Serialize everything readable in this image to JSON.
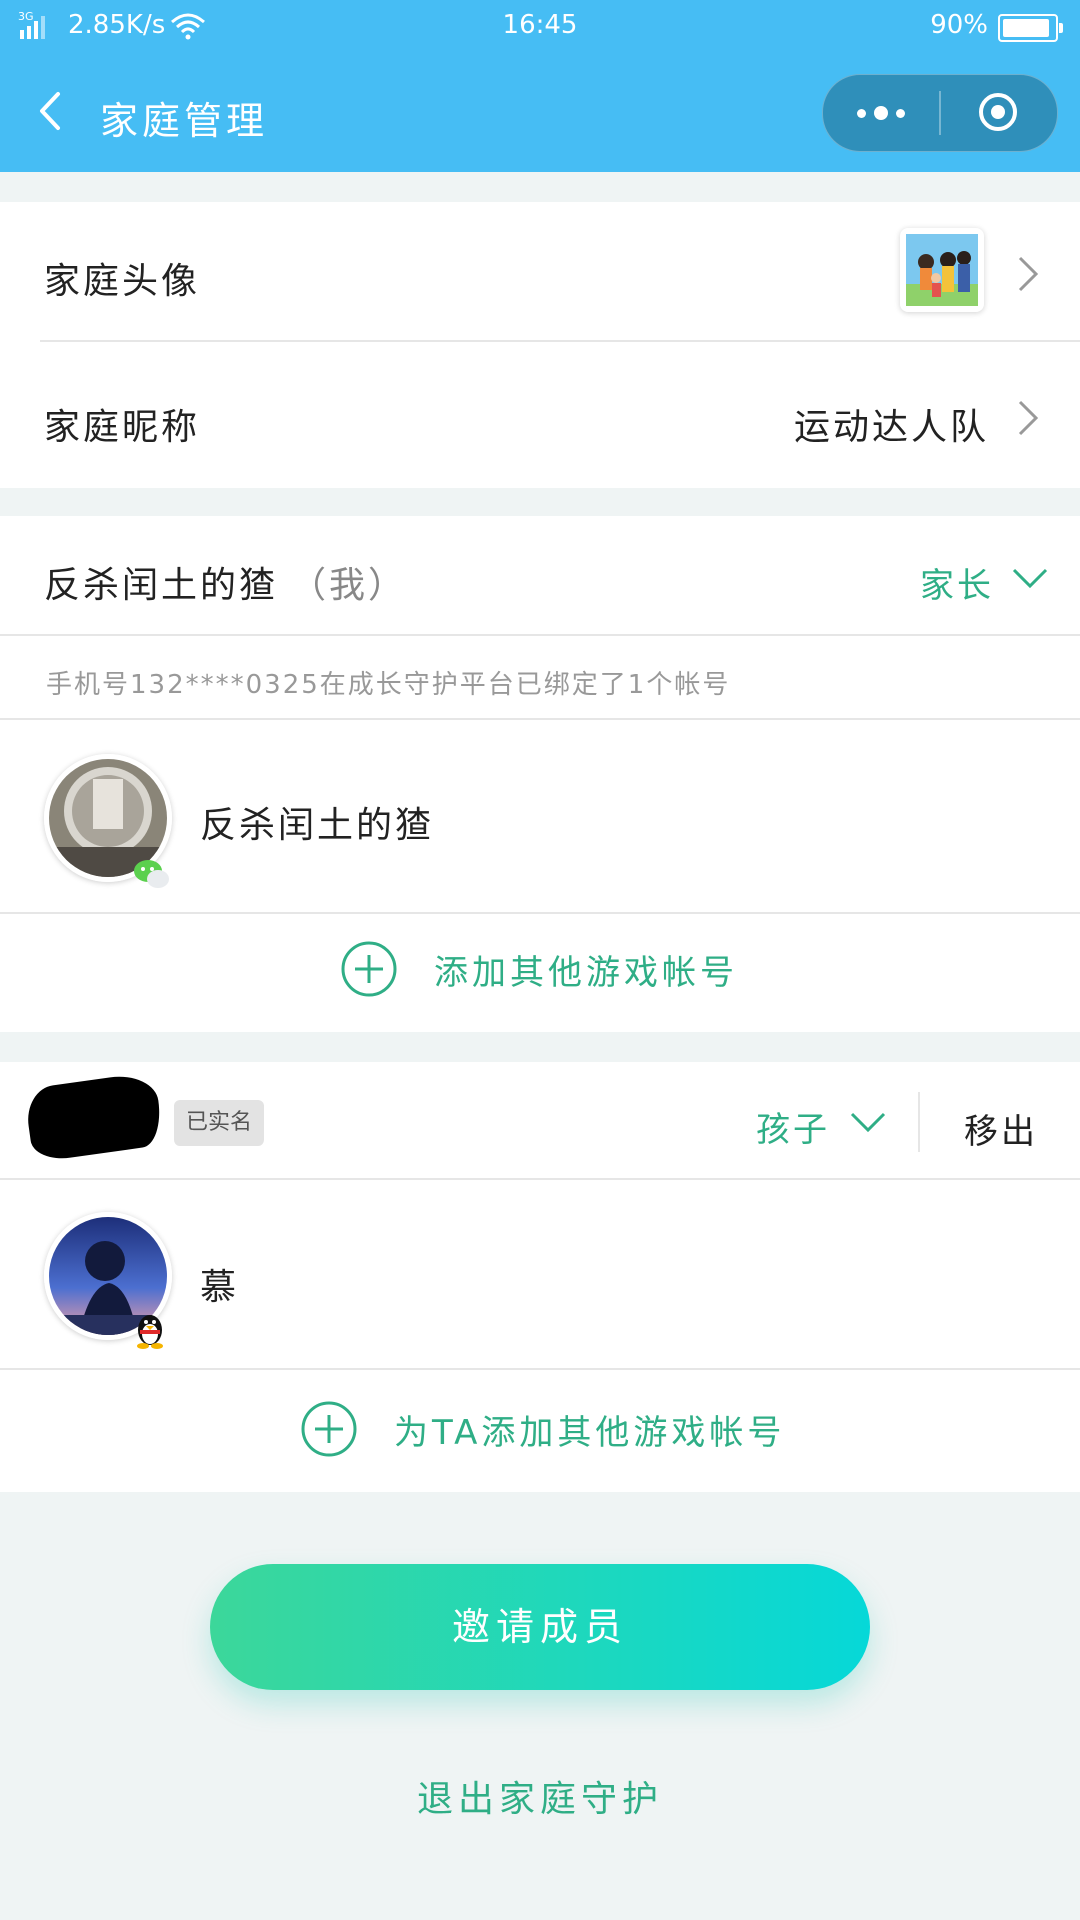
{
  "status_bar": {
    "network": "3G",
    "speed": "2.85K/s",
    "time": "16:45",
    "battery": "90%",
    "battery_level": 0.9
  },
  "nav": {
    "title": "家庭管理"
  },
  "family_info": {
    "avatar_label": "家庭头像",
    "nickname_label": "家庭昵称",
    "nickname_value": "运动达人队"
  },
  "parent_member": {
    "name": "反杀闰土的猹",
    "me_tag": "（我）",
    "role": "家长",
    "phone_note": "手机号132****0325在成长守护平台已绑定了1个帐号",
    "account_name": "反杀闰土的猹",
    "add_account_label": "添加其他游戏帐号"
  },
  "child_member": {
    "verified_tag": "已实名",
    "role": "孩子",
    "remove_label": "移出",
    "account_name": "慕",
    "add_account_label": "为TA添加其他游戏帐号"
  },
  "actions": {
    "invite_label": "邀请成员",
    "quit_label": "退出家庭守护"
  },
  "colors": {
    "nav_bg": "#46bdf4",
    "accent_green": "#2fae86",
    "gradient_start": "#3cd79a",
    "gradient_end": "#06d8d8"
  }
}
